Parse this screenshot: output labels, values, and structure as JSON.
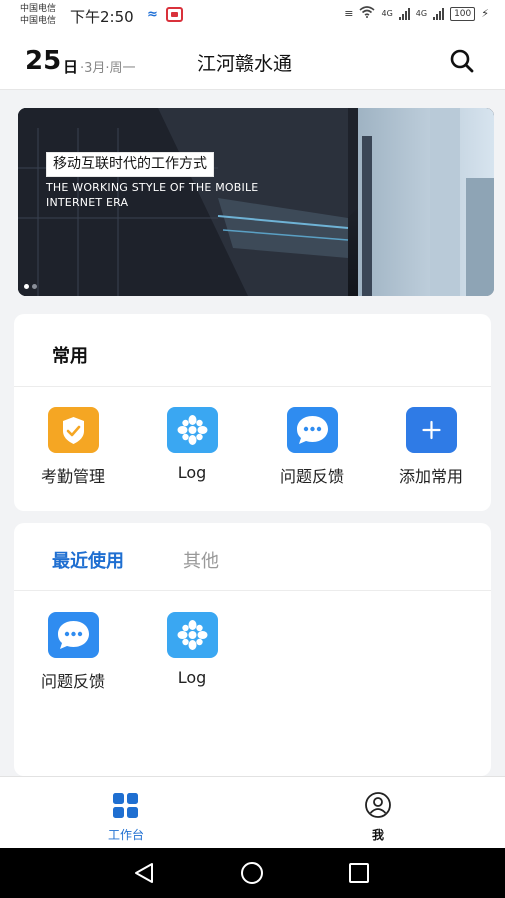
{
  "status_bar": {
    "carrier_1": "中国电信",
    "carrier_2": "中国电信",
    "time": "下午2:50",
    "net_1": "4G",
    "net_2": "4G",
    "battery": "100"
  },
  "header": {
    "day": "25",
    "day_suffix": "日",
    "month_weekday": "·3月·周一",
    "title": "江河赣水通",
    "search_icon": "search-icon"
  },
  "banner": {
    "headline_cn": "移动互联时代的工作方式",
    "headline_en": "THE WORKING STYLE OF THE MOBILE INTERNET ERA",
    "slide_count": 2,
    "active_slide": 1
  },
  "common_section": {
    "title": "常用",
    "apps": [
      {
        "label": "考勤管理",
        "icon": "attendance-check-icon",
        "color": "#f5a623"
      },
      {
        "label": "Log",
        "icon": "log-flower-icon",
        "color": "#3aa7f2"
      },
      {
        "label": "问题反馈",
        "icon": "chat-bubble-icon",
        "color": "#2f8cf0"
      },
      {
        "label": "添加常用",
        "icon": "plus-icon",
        "color": "#2f7be6"
      }
    ]
  },
  "recent_section": {
    "tabs": [
      {
        "label": "最近使用",
        "active": true
      },
      {
        "label": "其他",
        "active": false
      }
    ],
    "apps": [
      {
        "label": "问题反馈",
        "icon": "chat-bubble-icon",
        "color": "#2f8cf0"
      },
      {
        "label": "Log",
        "icon": "log-flower-icon",
        "color": "#3aa7f2"
      }
    ]
  },
  "bottom_nav": {
    "items": [
      {
        "label": "工作台",
        "icon": "workbench-grid-icon",
        "active": true
      },
      {
        "label": "我",
        "icon": "user-profile-icon",
        "active": false
      }
    ]
  },
  "colors": {
    "accent": "#1f6fd1",
    "page_bg": "#f2f3f5",
    "inactive_text": "#999999"
  }
}
